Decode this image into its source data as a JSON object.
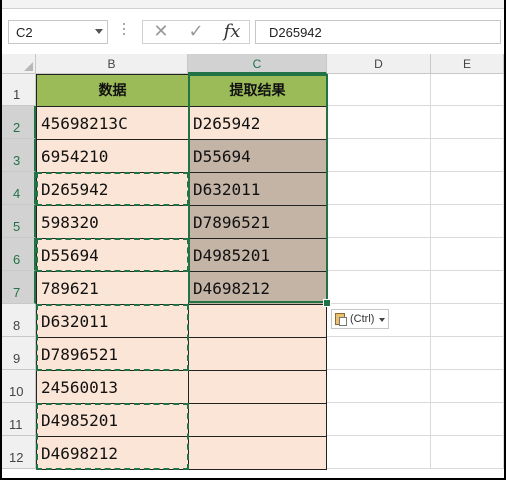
{
  "name_box": {
    "value": "C2"
  },
  "formula_bar": {
    "value": "D265942",
    "fx_label": "fx",
    "cancel_symbol": "✕",
    "enter_symbol": "✓"
  },
  "columns": [
    "B",
    "C",
    "D",
    "E"
  ],
  "rows": [
    "1",
    "2",
    "3",
    "4",
    "5",
    "6",
    "7",
    "8",
    "9",
    "10",
    "11",
    "12"
  ],
  "headers": {
    "b": "数据",
    "c": "提取结果"
  },
  "data_column": [
    "45698213C",
    "6954210",
    "D265942",
    "598320",
    "D55694",
    "789621",
    "D632011",
    "D7896521",
    "24560013",
    "D4985201",
    "D4698212"
  ],
  "result_column": [
    "D265942",
    "D55694",
    "D632011",
    "D7896521",
    "D4985201",
    "D4698212",
    "",
    "",
    "",
    "",
    ""
  ],
  "paste_options": {
    "label": "(Ctrl)"
  },
  "colors": {
    "header_green": "#9bbb59",
    "data_peach": "#fbe5d6",
    "selection_tan": "#c4b4a6",
    "excel_green": "#217346"
  }
}
